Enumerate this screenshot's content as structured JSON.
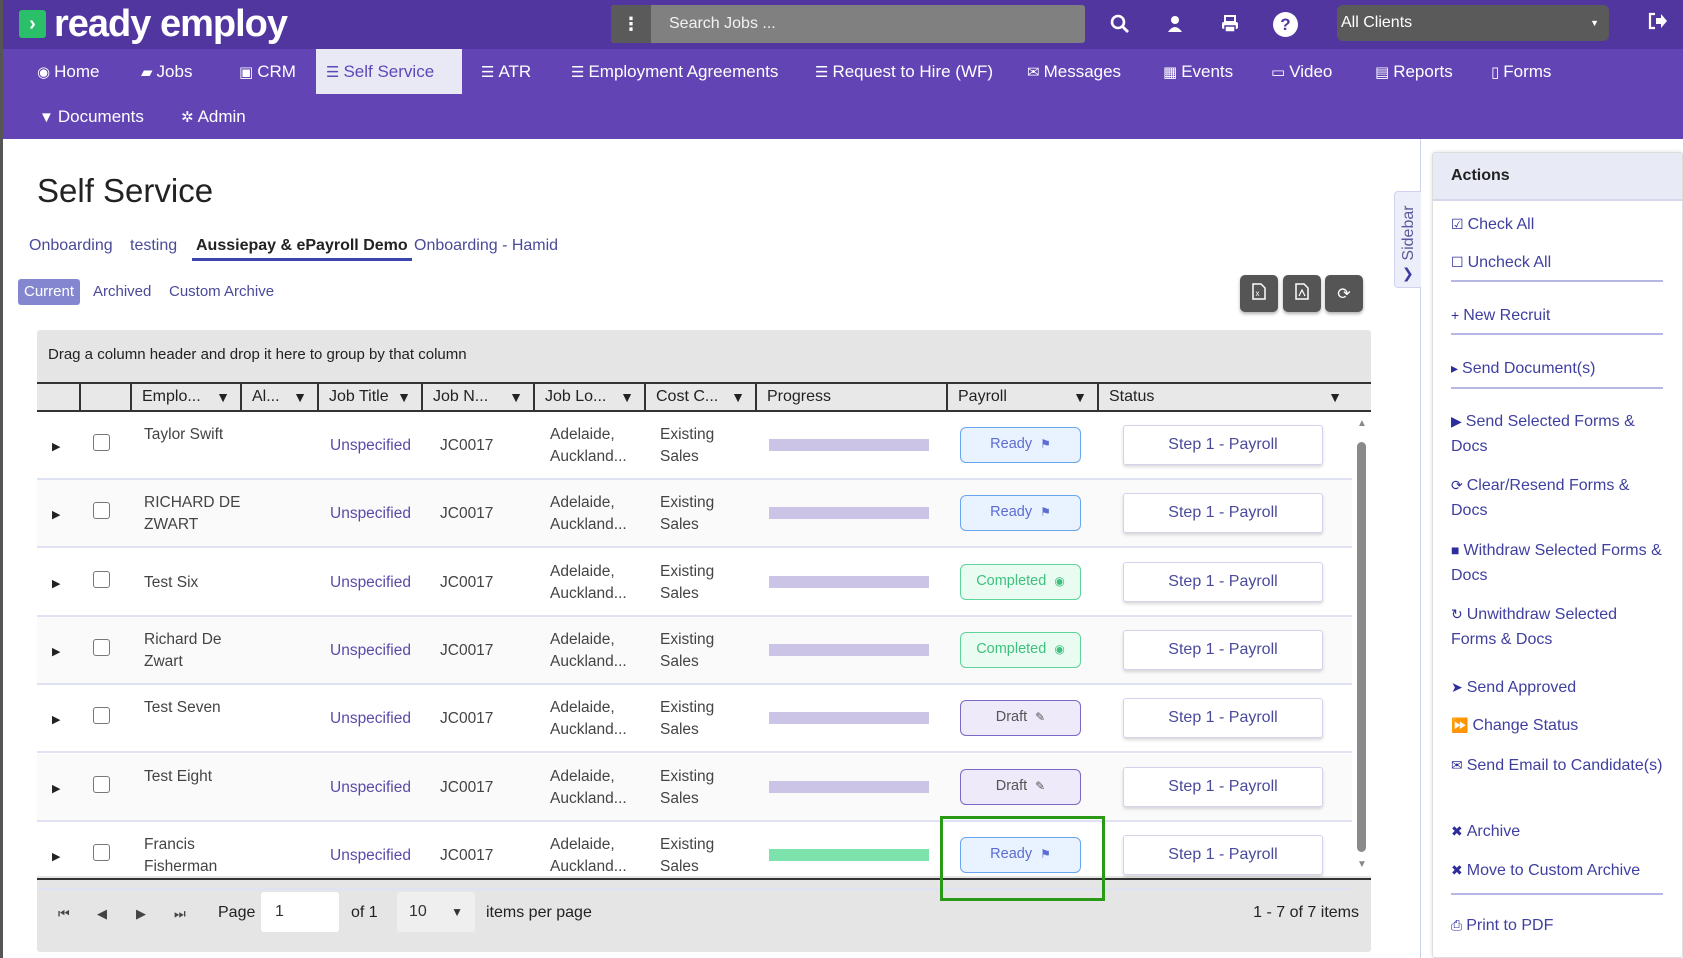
{
  "app": {
    "name": "ready employ",
    "logo_mark": "›"
  },
  "topbar": {
    "menu_icon": "⋮",
    "search_placeholder": "Search Jobs ...",
    "client_select": "All Clients"
  },
  "nav": {
    "items": [
      {
        "label": "Home",
        "icon": "◉"
      },
      {
        "label": "Jobs",
        "icon": "▰"
      },
      {
        "label": "CRM",
        "icon": "▣"
      },
      {
        "label": "Self Service",
        "icon": "☰"
      },
      {
        "label": "ATR",
        "icon": "☰"
      },
      {
        "label": "Employment Agreements",
        "icon": "☰"
      },
      {
        "label": "Request to Hire (WF)",
        "icon": "☰"
      },
      {
        "label": "Messages",
        "icon": "✉"
      },
      {
        "label": "Events",
        "icon": "▦"
      },
      {
        "label": "Video",
        "icon": "▭"
      },
      {
        "label": "Reports",
        "icon": "▤"
      },
      {
        "label": "Forms",
        "icon": "▯"
      },
      {
        "label": "Documents",
        "icon": "▼"
      },
      {
        "label": "Admin",
        "icon": "✲"
      }
    ],
    "active": "Self Service"
  },
  "page": {
    "title": "Self Service",
    "tabs": [
      "Onboarding",
      "testing",
      "Aussiepay & ePayroll Demo",
      "Onboarding - Hamid"
    ],
    "active_tab": "Aussiepay & ePayroll Demo",
    "subtabs": [
      "Current",
      "Archived",
      "Custom Archive"
    ],
    "active_subtab": "Current"
  },
  "grid": {
    "group_hint": "Drag a column header and drop it here to group by that column",
    "columns": [
      "Emplo...",
      "Al...",
      "Job Title",
      "Job N...",
      "Job Lo...",
      "Cost C...",
      "Progress",
      "Payroll",
      "Status"
    ],
    "rows": [
      {
        "name": "Taylor Swift",
        "job_title": "Unspecified",
        "job_no": "JC0017",
        "location": "Adelaide, Auckland...",
        "cost_centre": "Existing Sales",
        "progress": 0,
        "payroll": "Ready",
        "payroll_type": "ready",
        "status": "Step 1 - Payroll"
      },
      {
        "name": "RICHARD DE ZWART",
        "job_title": "Unspecified",
        "job_no": "JC0017",
        "location": "Adelaide, Auckland...",
        "cost_centre": "Existing Sales",
        "progress": 0,
        "payroll": "Ready",
        "payroll_type": "ready",
        "status": "Step 1 - Payroll"
      },
      {
        "name": "Test Six",
        "job_title": "Unspecified",
        "job_no": "JC0017",
        "location": "Adelaide, Auckland...",
        "cost_centre": "Existing Sales",
        "progress": 0,
        "payroll": "Completed",
        "payroll_type": "completed",
        "status": "Step 1 - Payroll"
      },
      {
        "name": "Richard De Zwart",
        "job_title": "Unspecified",
        "job_no": "JC0017",
        "location": "Adelaide, Auckland...",
        "cost_centre": "Existing Sales",
        "progress": 0,
        "payroll": "Completed",
        "payroll_type": "completed",
        "status": "Step 1 - Payroll"
      },
      {
        "name": "Test Seven",
        "job_title": "Unspecified",
        "job_no": "JC0017",
        "location": "Adelaide, Auckland...",
        "cost_centre": "Existing Sales",
        "progress": 0,
        "payroll": "Draft",
        "payroll_type": "draft",
        "status": "Step 1 - Payroll"
      },
      {
        "name": "Test Eight",
        "job_title": "Unspecified",
        "job_no": "JC0017",
        "location": "Adelaide, Auckland...",
        "cost_centre": "Existing Sales",
        "progress": 0,
        "payroll": "Draft",
        "payroll_type": "draft",
        "status": "Step 1 - Payroll"
      },
      {
        "name": "Francis Fisherman",
        "job_title": "Unspecified",
        "job_no": "JC0017",
        "location": "Adelaide, Auckland...",
        "cost_centre": "Existing Sales",
        "progress": 100,
        "payroll": "Ready",
        "payroll_type": "ready",
        "status": "Step 1 - Payroll"
      }
    ],
    "pager": {
      "page_label": "Page",
      "page_value": "1",
      "of_label": "of 1",
      "page_size": "10",
      "per_page_label": "items per page",
      "summary": "1 - 7 of 7 items"
    }
  },
  "sidebar": {
    "toggle_label": "Sidebar",
    "actions_title": "Actions",
    "actions": [
      {
        "label": "Check All",
        "icon": "☑"
      },
      {
        "label": "Uncheck All",
        "icon": "☐"
      },
      {
        "label": "New Recruit",
        "icon": "+"
      },
      {
        "label": "Send Document(s)",
        "icon": "▸"
      },
      {
        "label": "Send Selected Forms & Docs",
        "icon": "▶"
      },
      {
        "label": "Clear/Resend Forms & Docs",
        "icon": "⟳"
      },
      {
        "label": "Withdraw Selected Forms & Docs",
        "icon": "■"
      },
      {
        "label": "Unwithdraw Selected Forms & Docs",
        "icon": "↻"
      },
      {
        "label": "Send Approved",
        "icon": "➤"
      },
      {
        "label": "Change Status",
        "icon": "⏩"
      },
      {
        "label": "Send Email to Candidate(s)",
        "icon": "✉"
      },
      {
        "label": "Archive",
        "icon": "✖"
      },
      {
        "label": "Move to Custom Archive",
        "icon": "✖"
      },
      {
        "label": "Print to PDF",
        "icon": "⎙"
      }
    ]
  },
  "colors": {
    "topbar": "#5236a0",
    "nav": "#6244b5",
    "ready": "#6aa6ee",
    "completed": "#5ed39a",
    "draft": "#7e68c5",
    "highlight": "#2a9a16"
  }
}
